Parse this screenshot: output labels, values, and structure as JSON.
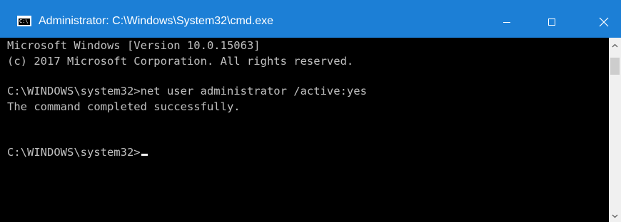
{
  "window": {
    "title": "Administrator: C:\\Windows\\System32\\cmd.exe",
    "app_icon": "cmd-icon",
    "app_icon_glyph": "C:\\",
    "titlebar_color": "#1c7fd6",
    "controls": {
      "minimize_icon": "minimize-icon",
      "maximize_icon": "maximize-icon",
      "close_icon": "close-icon"
    }
  },
  "console": {
    "background": "#000000",
    "text_color": "#c0c0c0",
    "lines": [
      "Microsoft Windows [Version 10.0.15063]",
      "(c) 2017 Microsoft Corporation. All rights reserved.",
      "",
      "C:\\WINDOWS\\system32>net user administrator /active:yes",
      "The command completed successfully.",
      "",
      "",
      "C:\\WINDOWS\\system32>"
    ]
  },
  "scrollbar": {
    "up_icon": "chevron-up-icon",
    "down_icon": "chevron-down-icon"
  }
}
